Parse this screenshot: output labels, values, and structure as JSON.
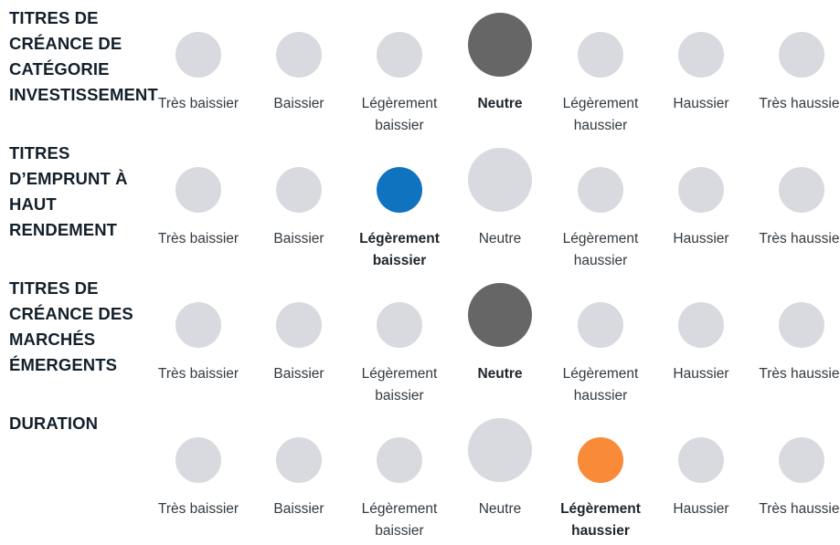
{
  "scale_labels": [
    "Très baissier",
    "Baissier",
    "Légèrement baissier",
    "Neutre",
    "Légèrement haussier",
    "Haussier",
    "Très haussier"
  ],
  "colors": {
    "inactive": "#d8dadf",
    "neutral_selected": "#666666",
    "bearish_selected": "#0f73bf",
    "bullish_selected": "#f98a37"
  },
  "rows": [
    {
      "category": "TITRES DE CRÉANCE DE CATÉGORIE INVESTISSEMENT",
      "selected_index": 3,
      "selected_label": "Neutre",
      "selected_color": "#666666",
      "options": [
        "Très baissier",
        "Baissier",
        "Légèrement baissier",
        "Neutre",
        "Légèrement haussier",
        "Haussier",
        "Très haussier"
      ]
    },
    {
      "category": "TITRES D’EMPRUNT À HAUT RENDEMENT",
      "selected_index": 2,
      "selected_label": "Légèrement baissier",
      "selected_color": "#0f73bf",
      "options": [
        "Très baissier",
        "Baissier",
        "Légèrement baissier",
        "Neutre",
        "Légèrement haussier",
        "Haussier",
        "Très haussier"
      ]
    },
    {
      "category": "TITRES DE CRÉANCE DES MARCHÉS ÉMERGENTS",
      "selected_index": 3,
      "selected_label": "Neutre",
      "selected_color": "#666666",
      "options": [
        "Très baissier",
        "Baissier",
        "Légèrement baissier",
        "Neutre",
        "Légèrement haussier",
        "Haussier",
        "Très haussier"
      ]
    },
    {
      "category": "DURATION",
      "selected_index": 4,
      "selected_label": "Légèrement haussier",
      "selected_color": "#f98a37",
      "options": [
        "Très baissier",
        "Baissier",
        "Légèrement baissier",
        "Neutre",
        "Légèrement haussier",
        "Haussier",
        "Très haussier"
      ]
    }
  ]
}
